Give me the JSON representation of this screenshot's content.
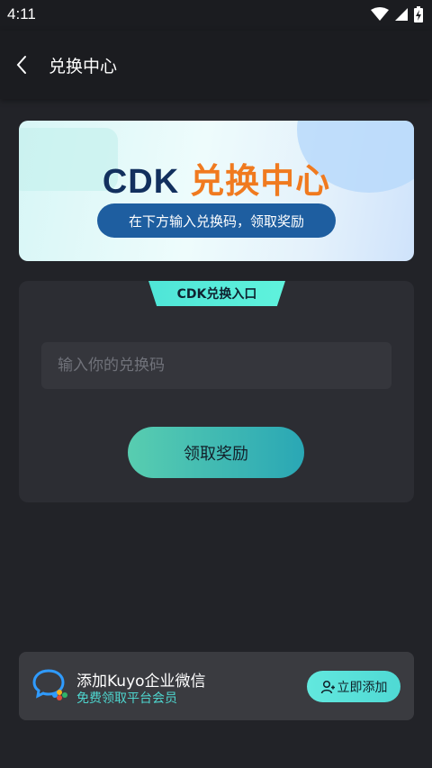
{
  "status": {
    "time": "4:11"
  },
  "header": {
    "title": "兑换中心"
  },
  "banner": {
    "title_prefix": "CDK",
    "title_highlight": "兑换中心",
    "subtitle": "在下方输入兑换码，领取奖励"
  },
  "redeem": {
    "tab_label": "CDK兑换入口",
    "input_placeholder": "输入你的兑换码",
    "input_value": "",
    "button_label": "领取奖励"
  },
  "wechat": {
    "title": "添加Kuyo企业微信",
    "subtitle": "免费领取平台会员",
    "button_label": "立即添加"
  },
  "colors": {
    "background": "#222328",
    "accent": "#4fe5d7",
    "highlight": "#f07a1f",
    "banner_pill": "#1e5ea0"
  },
  "icons": [
    "wifi-icon",
    "signal-icon",
    "battery-icon",
    "back-arrow-icon",
    "wecom-icon",
    "add-user-icon"
  ]
}
